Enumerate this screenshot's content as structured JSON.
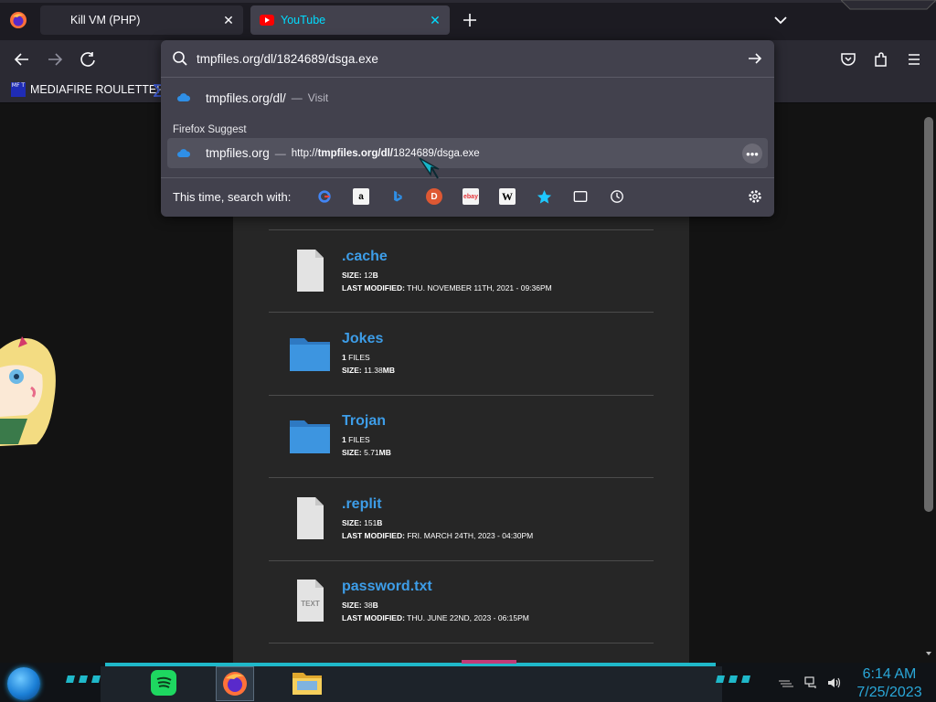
{
  "browser": {
    "tabs": [
      {
        "title": "Kill VM (PHP)",
        "active": false
      },
      {
        "title": "YouTube",
        "active": true
      }
    ]
  },
  "bookmarks": [
    {
      "label": "MEDIAFIRE ROULETTER",
      "icon_text": "MF T"
    }
  ],
  "urlbar": {
    "value": "tmpfiles.org/dl/1824689/dsga.exe",
    "results": [
      {
        "title": "tmpfiles.org/dl/",
        "separator": "—",
        "action": "Visit"
      }
    ],
    "suggest_heading": "Firefox Suggest",
    "suggestion": {
      "title": "tmpfiles.org",
      "separator": "—",
      "url_prefix": "http://",
      "url_bold": "tmpfiles.org/dl/",
      "url_rest": "1824689/dsga.exe"
    },
    "search_with_label": "This time, search with:",
    "engines": [
      "google-icon",
      "amazon-icon",
      "bing-icon",
      "duckduckgo-icon",
      "ebay-icon",
      "wikipedia-icon",
      "bookmarks-star-icon",
      "tabs-icon",
      "history-icon"
    ]
  },
  "files": [
    {
      "name": ".cache",
      "type": "file",
      "size_label": "SIZE:",
      "size": "12",
      "size_unit": "B",
      "modified_label": "LAST MODIFIED:",
      "modified": "THU. NOVEMBER 11TH, 2021 - 09:36PM"
    },
    {
      "name": "Jokes",
      "type": "folder",
      "count": "1",
      "count_unit": "FILES",
      "size_label": "SIZE:",
      "size": "11.38",
      "size_unit": "MB"
    },
    {
      "name": "Trojan",
      "type": "folder",
      "count": "1",
      "count_unit": "FILES",
      "size_label": "SIZE:",
      "size": "5.71",
      "size_unit": "MB"
    },
    {
      "name": ".replit",
      "type": "file",
      "size_label": "SIZE:",
      "size": "151",
      "size_unit": "B",
      "modified_label": "LAST MODIFIED:",
      "modified": "FRI. MARCH 24TH, 2023 - 04:30PM"
    },
    {
      "name": "password.txt",
      "type": "text",
      "icon_text": "TEXT",
      "size_label": "SIZE:",
      "size": "38",
      "size_unit": "B",
      "modified_label": "LAST MODIFIED:",
      "modified": "THU. JUNE 22ND, 2023 - 06:15PM"
    }
  ],
  "taskbar": {
    "time": "6:14 AM",
    "date": "7/25/2023",
    "apps": [
      "spotify-icon",
      "firefox-icon",
      "file-explorer-icon"
    ],
    "accent": "#1fb8c9"
  },
  "colors": {
    "link": "#3d9de8",
    "popup_bg": "#42414d",
    "toolbar_bg": "#2b2a33",
    "youtube_tab_text": "#00ddff"
  }
}
